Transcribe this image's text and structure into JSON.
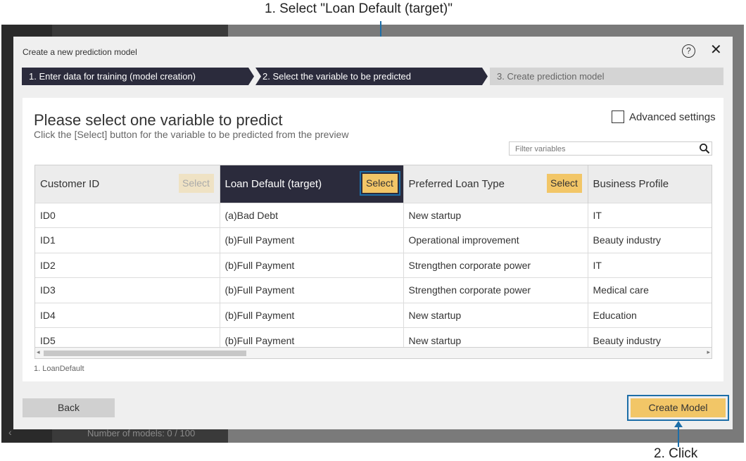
{
  "annotations": {
    "step1": "1. Select \"Loan Default (target)\"",
    "step2": "2. Click"
  },
  "background": {
    "models_count": "Number of models: 0 / 100"
  },
  "dialog": {
    "title": "Create a new prediction model",
    "help_glyph": "?",
    "close_glyph": "✕",
    "steps": [
      {
        "label": "1. Enter data for training (model creation)",
        "state": "active"
      },
      {
        "label": "2. Select the variable to be predicted",
        "state": "active"
      },
      {
        "label": "3. Create prediction model",
        "state": "inactive"
      }
    ],
    "heading": "Please select one variable to predict",
    "subheading": "Click the [Select] button for the variable to be predicted from the preview",
    "advanced_settings_label": "Advanced settings",
    "filter_placeholder": "Filter variables",
    "table": {
      "select_label": "Select",
      "columns": [
        {
          "name": "Customer ID",
          "select_state": "disabled"
        },
        {
          "name": "Loan Default (target)",
          "select_state": "selected"
        },
        {
          "name": "Preferred Loan Type",
          "select_state": "enabled"
        },
        {
          "name": "Business Profile",
          "select_state": "none"
        }
      ],
      "rows": [
        [
          "ID0",
          "(a)Bad Debt",
          "New startup",
          "IT"
        ],
        [
          "ID1",
          "(b)Full Payment",
          "Operational improvement",
          "Beauty industry"
        ],
        [
          "ID2",
          "(b)Full Payment",
          "Strengthen corporate power",
          "IT"
        ],
        [
          "ID3",
          "(b)Full Payment",
          "Strengthen corporate power",
          "Medical care"
        ],
        [
          "ID4",
          "(b)Full Payment",
          "New startup",
          "Education"
        ],
        [
          "ID5",
          "(b)Full Payment",
          "New startup",
          "Beauty industry"
        ]
      ]
    },
    "footnote": "1. LoanDefault",
    "back_label": "Back",
    "create_label": "Create Model"
  },
  "colors": {
    "accent_yellow": "#f2c667",
    "dark_header": "#2b2b3c",
    "annotation_blue": "#1d6ea8"
  }
}
